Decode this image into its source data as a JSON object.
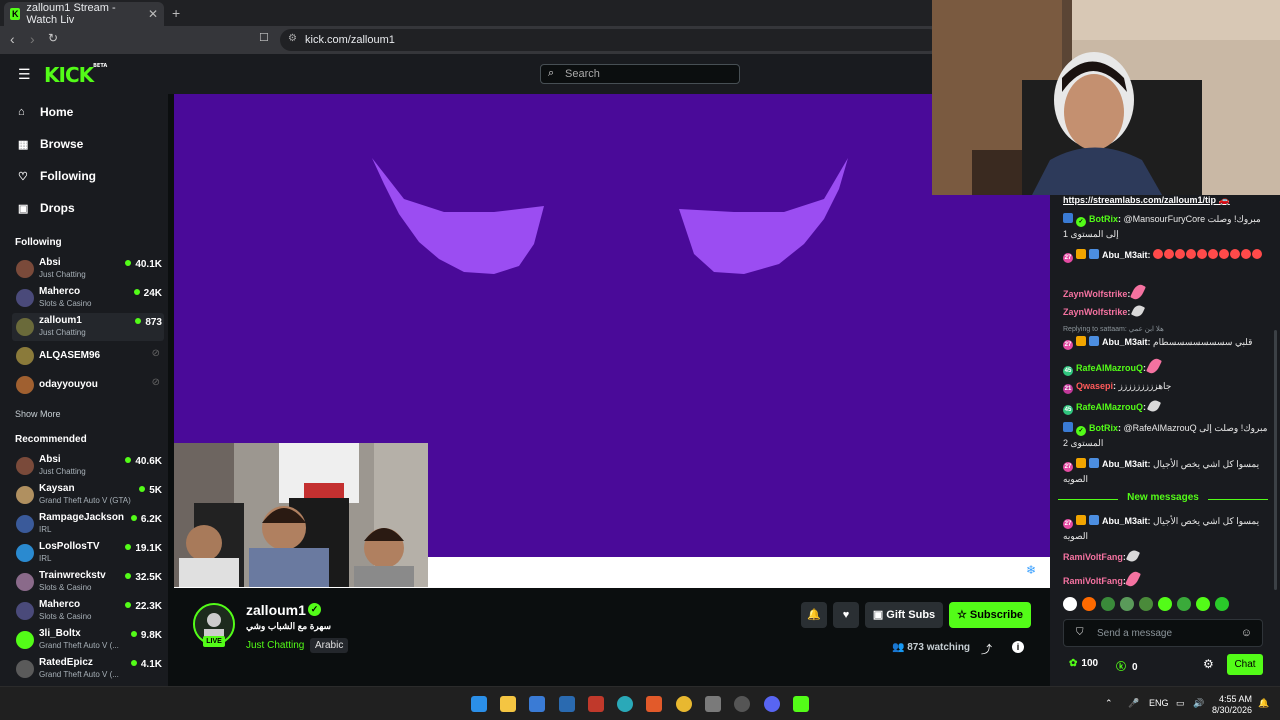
{
  "browser": {
    "tab_title": "zalloum1 Stream - Watch Liv",
    "tab_close": "✕",
    "new_tab": "+",
    "url": "kick.com/zalloum1"
  },
  "topbar": {
    "logo": "KICK",
    "logo_badge": "BETA",
    "search_placeholder": "Search"
  },
  "sidebar": {
    "nav": [
      {
        "label": "Home",
        "icon": "home-icon"
      },
      {
        "label": "Browse",
        "icon": "browse-icon"
      },
      {
        "label": "Following",
        "icon": "heart-icon"
      },
      {
        "label": "Drops",
        "icon": "gift-icon"
      }
    ],
    "following_header": "Following",
    "following": [
      {
        "name": "Absi",
        "category": "Just Chatting",
        "viewers": "40.1K",
        "live": true,
        "color": "#7a4a3a"
      },
      {
        "name": "Maherco",
        "category": "Slots & Casino",
        "viewers": "24K",
        "live": true,
        "color": "#4a4a7a"
      },
      {
        "name": "zalloum1",
        "category": "Just Chatting",
        "viewers": "873",
        "live": true,
        "color": "#6a6a3a"
      },
      {
        "name": "ALQASEM96",
        "category": "",
        "viewers": "",
        "live": false,
        "color": "#8a7a3a"
      },
      {
        "name": "odayyouyou",
        "category": "",
        "viewers": "",
        "live": false,
        "color": "#a06030"
      }
    ],
    "show_more": "Show More",
    "recommended_header": "Recommended",
    "recommended": [
      {
        "name": "Absi",
        "category": "Just Chatting",
        "viewers": "40.6K",
        "color": "#7a4a3a"
      },
      {
        "name": "Kaysan",
        "category": "Grand Theft Auto V (GTA)",
        "viewers": "5K",
        "color": "#b09060"
      },
      {
        "name": "RampageJackson",
        "category": "IRL",
        "viewers": "6.2K",
        "color": "#3a5a9a"
      },
      {
        "name": "LosPollosTV",
        "category": "IRL",
        "viewers": "19.1K",
        "color": "#2a8ad0"
      },
      {
        "name": "Trainwreckstv",
        "category": "Slots & Casino",
        "viewers": "32.5K",
        "color": "#8a6a8a"
      },
      {
        "name": "Maherco",
        "category": "Slots & Casino",
        "viewers": "22.3K",
        "color": "#4a4a7a"
      },
      {
        "name": "3li_Boltx",
        "category": "Grand Theft Auto V (...",
        "viewers": "9.8K",
        "color": "#53fc18"
      },
      {
        "name": "RatedEpicz",
        "category": "Grand Theft Auto V (...",
        "viewers": "4.1K",
        "color": "#5a5a5a"
      }
    ]
  },
  "stream": {
    "streamer": "zalloum1",
    "live_badge": "LIVE",
    "title": "سهرة مع الشباب وشي",
    "category": "Just Chatting",
    "language": "Arabic",
    "gift_subs": "Gift Subs",
    "subscribe": "Subscribe",
    "watching_count": "873",
    "watching_label": "watching"
  },
  "chat": {
    "pinned_link": "https://streamlabs.com/zalloum1/tip",
    "messages": [
      {
        "badges": [
          "bot",
          "verified"
        ],
        "user": "BotRix",
        "color": "#53fc18",
        "text": "@MansourFuryCore مبروك! وصلت إلى المستوى 1"
      },
      {
        "badges": [
          "sub27",
          "crown",
          "gift"
        ],
        "user": "Abu_M3ait",
        "color": "#ffffff",
        "text": "",
        "emotes": 10
      },
      {
        "badges": [],
        "user": "ZaynWolfstrike",
        "color": "#f472a0",
        "text": "",
        "feather": "pink"
      },
      {
        "badges": [],
        "user": "ZaynWolfstrike",
        "color": "#f472a0",
        "text": "",
        "feather": "white"
      },
      {
        "badges": [
          "sub27",
          "crown",
          "gift"
        ],
        "user": "Abu_M3ait",
        "color": "#ffffff",
        "text": "قلبي سسسسسسسسطام",
        "reply": "Replying to sattaam: هلا ابن عمي"
      },
      {
        "badges": [
          "sub45"
        ],
        "user": "RafeAlMazrouQ",
        "color": "#53fc18",
        "text": "",
        "feather": "pink"
      },
      {
        "badges": [
          "sub21"
        ],
        "user": "Qwasepi",
        "color": "#ff5a5a",
        "text": "جاهززززززززز"
      },
      {
        "badges": [
          "sub45"
        ],
        "user": "RafeAlMazrouQ",
        "color": "#53fc18",
        "text": "",
        "feather": "white"
      },
      {
        "badges": [
          "bot",
          "verified"
        ],
        "user": "BotRix",
        "color": "#53fc18",
        "text": "@RafeAlMazrouQ مبروك! وصلت إلى المستوى 2"
      },
      {
        "badges": [
          "sub27",
          "crown",
          "gift"
        ],
        "user": "Abu_M3ait",
        "color": "#ffffff",
        "text": "يمسوا كل اشي يخص الأجيال الصويه"
      }
    ],
    "new_messages": "New messages",
    "after": [
      {
        "badges": [
          "sub27",
          "crown",
          "gift"
        ],
        "user": "Abu_M3ait",
        "color": "#ffffff",
        "text": "يمسوا كل اشي يخص الأجيال الصويه"
      },
      {
        "badges": [],
        "user": "RamiVoltFang",
        "color": "#f472a0",
        "text": "",
        "feather": "white"
      },
      {
        "badges": [],
        "user": "RamiVoltFang",
        "color": "#f472a0",
        "text": "",
        "feather": "pink"
      }
    ],
    "input_placeholder": "Send a message",
    "points": "100",
    "kick_coins": "0",
    "chat_button": "Chat"
  },
  "taskbar": {
    "lang": "ENG",
    "time": "4:55 AM",
    "date": "8/30/2026"
  }
}
